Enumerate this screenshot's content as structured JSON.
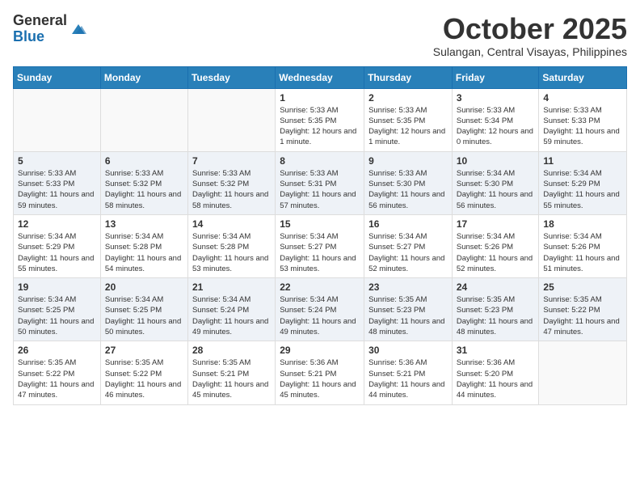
{
  "header": {
    "logo_general": "General",
    "logo_blue": "Blue",
    "month_title": "October 2025",
    "location": "Sulangan, Central Visayas, Philippines"
  },
  "weekdays": [
    "Sunday",
    "Monday",
    "Tuesday",
    "Wednesday",
    "Thursday",
    "Friday",
    "Saturday"
  ],
  "weeks": [
    [
      {
        "day": "",
        "info": ""
      },
      {
        "day": "",
        "info": ""
      },
      {
        "day": "",
        "info": ""
      },
      {
        "day": "1",
        "info": "Sunrise: 5:33 AM\nSunset: 5:35 PM\nDaylight: 12 hours\nand 1 minute."
      },
      {
        "day": "2",
        "info": "Sunrise: 5:33 AM\nSunset: 5:35 PM\nDaylight: 12 hours\nand 1 minute."
      },
      {
        "day": "3",
        "info": "Sunrise: 5:33 AM\nSunset: 5:34 PM\nDaylight: 12 hours\nand 0 minutes."
      },
      {
        "day": "4",
        "info": "Sunrise: 5:33 AM\nSunset: 5:33 PM\nDaylight: 11 hours\nand 59 minutes."
      }
    ],
    [
      {
        "day": "5",
        "info": "Sunrise: 5:33 AM\nSunset: 5:33 PM\nDaylight: 11 hours\nand 59 minutes."
      },
      {
        "day": "6",
        "info": "Sunrise: 5:33 AM\nSunset: 5:32 PM\nDaylight: 11 hours\nand 58 minutes."
      },
      {
        "day": "7",
        "info": "Sunrise: 5:33 AM\nSunset: 5:32 PM\nDaylight: 11 hours\nand 58 minutes."
      },
      {
        "day": "8",
        "info": "Sunrise: 5:33 AM\nSunset: 5:31 PM\nDaylight: 11 hours\nand 57 minutes."
      },
      {
        "day": "9",
        "info": "Sunrise: 5:33 AM\nSunset: 5:30 PM\nDaylight: 11 hours\nand 56 minutes."
      },
      {
        "day": "10",
        "info": "Sunrise: 5:34 AM\nSunset: 5:30 PM\nDaylight: 11 hours\nand 56 minutes."
      },
      {
        "day": "11",
        "info": "Sunrise: 5:34 AM\nSunset: 5:29 PM\nDaylight: 11 hours\nand 55 minutes."
      }
    ],
    [
      {
        "day": "12",
        "info": "Sunrise: 5:34 AM\nSunset: 5:29 PM\nDaylight: 11 hours\nand 55 minutes."
      },
      {
        "day": "13",
        "info": "Sunrise: 5:34 AM\nSunset: 5:28 PM\nDaylight: 11 hours\nand 54 minutes."
      },
      {
        "day": "14",
        "info": "Sunrise: 5:34 AM\nSunset: 5:28 PM\nDaylight: 11 hours\nand 53 minutes."
      },
      {
        "day": "15",
        "info": "Sunrise: 5:34 AM\nSunset: 5:27 PM\nDaylight: 11 hours\nand 53 minutes."
      },
      {
        "day": "16",
        "info": "Sunrise: 5:34 AM\nSunset: 5:27 PM\nDaylight: 11 hours\nand 52 minutes."
      },
      {
        "day": "17",
        "info": "Sunrise: 5:34 AM\nSunset: 5:26 PM\nDaylight: 11 hours\nand 52 minutes."
      },
      {
        "day": "18",
        "info": "Sunrise: 5:34 AM\nSunset: 5:26 PM\nDaylight: 11 hours\nand 51 minutes."
      }
    ],
    [
      {
        "day": "19",
        "info": "Sunrise: 5:34 AM\nSunset: 5:25 PM\nDaylight: 11 hours\nand 50 minutes."
      },
      {
        "day": "20",
        "info": "Sunrise: 5:34 AM\nSunset: 5:25 PM\nDaylight: 11 hours\nand 50 minutes."
      },
      {
        "day": "21",
        "info": "Sunrise: 5:34 AM\nSunset: 5:24 PM\nDaylight: 11 hours\nand 49 minutes."
      },
      {
        "day": "22",
        "info": "Sunrise: 5:34 AM\nSunset: 5:24 PM\nDaylight: 11 hours\nand 49 minutes."
      },
      {
        "day": "23",
        "info": "Sunrise: 5:35 AM\nSunset: 5:23 PM\nDaylight: 11 hours\nand 48 minutes."
      },
      {
        "day": "24",
        "info": "Sunrise: 5:35 AM\nSunset: 5:23 PM\nDaylight: 11 hours\nand 48 minutes."
      },
      {
        "day": "25",
        "info": "Sunrise: 5:35 AM\nSunset: 5:22 PM\nDaylight: 11 hours\nand 47 minutes."
      }
    ],
    [
      {
        "day": "26",
        "info": "Sunrise: 5:35 AM\nSunset: 5:22 PM\nDaylight: 11 hours\nand 47 minutes."
      },
      {
        "day": "27",
        "info": "Sunrise: 5:35 AM\nSunset: 5:22 PM\nDaylight: 11 hours\nand 46 minutes."
      },
      {
        "day": "28",
        "info": "Sunrise: 5:35 AM\nSunset: 5:21 PM\nDaylight: 11 hours\nand 45 minutes."
      },
      {
        "day": "29",
        "info": "Sunrise: 5:36 AM\nSunset: 5:21 PM\nDaylight: 11 hours\nand 45 minutes."
      },
      {
        "day": "30",
        "info": "Sunrise: 5:36 AM\nSunset: 5:21 PM\nDaylight: 11 hours\nand 44 minutes."
      },
      {
        "day": "31",
        "info": "Sunrise: 5:36 AM\nSunset: 5:20 PM\nDaylight: 11 hours\nand 44 minutes."
      },
      {
        "day": "",
        "info": ""
      }
    ]
  ]
}
